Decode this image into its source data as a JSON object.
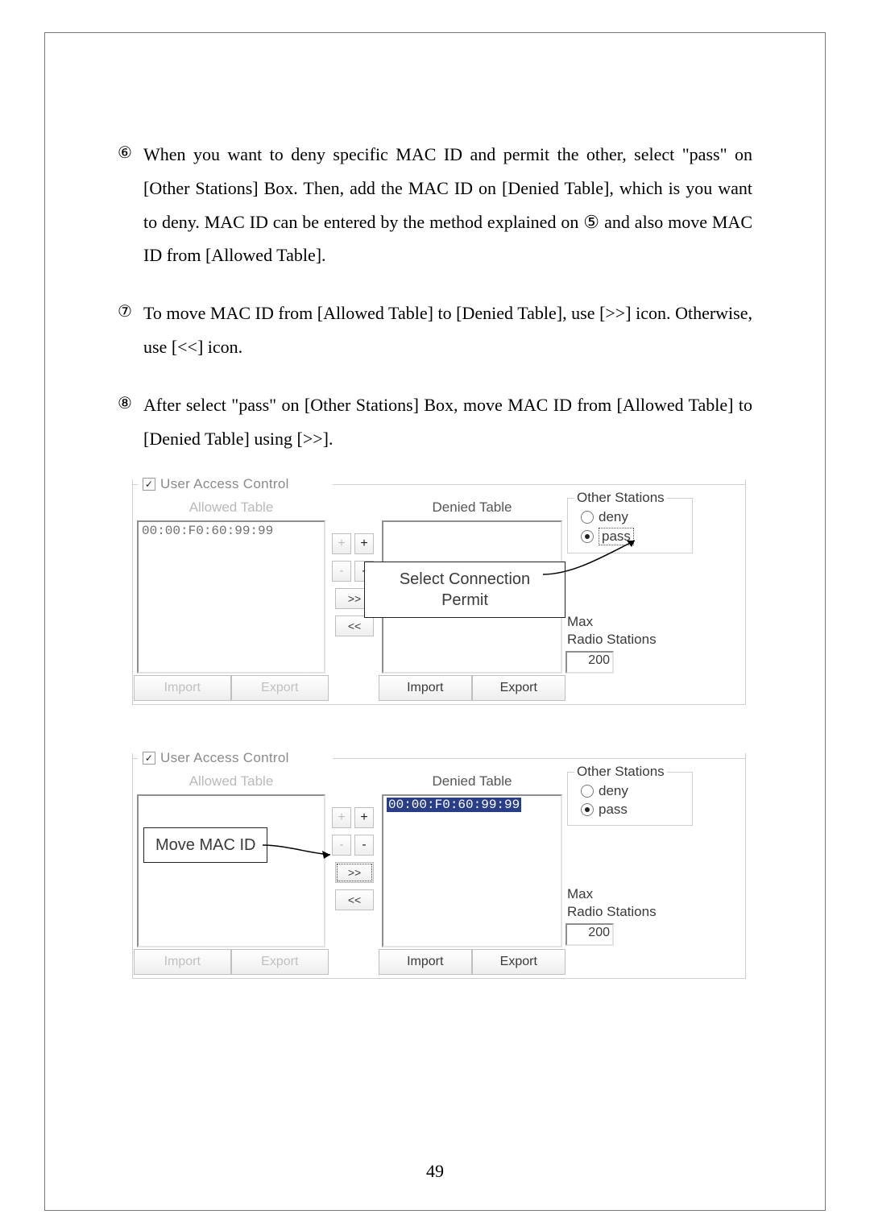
{
  "instructions": {
    "item6": "When you want to deny specific MAC ID and permit the other, select \"pass\" on [Other Stations] Box. Then, add the MAC ID on [Denied Table], which is you want to deny. MAC ID can be entered by the method explained on  ⑤  and also move MAC ID from [Allowed Table].",
    "item7": "To move MAC ID from [Allowed Table] to [Denied Table], use [>>] icon. Otherwise, use [<<] icon.",
    "item8": "After select \"pass\" on [Other Stations] Box, move MAC ID from [Allowed Table] to [Denied Table] using [>>]."
  },
  "markers": {
    "six": "⑥",
    "seven": "⑦",
    "eight": "⑧"
  },
  "uac": {
    "title": "User Access Control",
    "checkbox_mark": "✓",
    "allowed_title": "Allowed Table",
    "denied_title": "Denied Table",
    "mac": "00:00:F0:60:99:99",
    "plus": "+",
    "minus": "-",
    "move_right": ">>",
    "move_left": "<<",
    "import": "Import",
    "export": "Export",
    "other_stations": "Other Stations",
    "deny": "deny",
    "pass": "pass",
    "max_label_1": "Max",
    "max_label_2": "Radio Stations",
    "max_value": "200"
  },
  "callouts": {
    "select_permit_1": "Select Connection",
    "select_permit_2": "Permit",
    "move_mac": "Move MAC ID"
  },
  "page_number": "49"
}
